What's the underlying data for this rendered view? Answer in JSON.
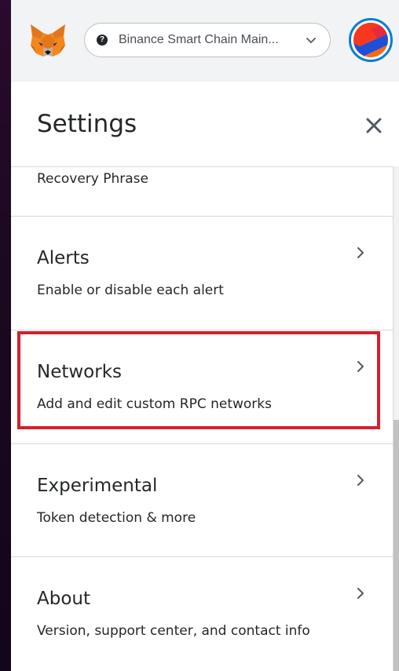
{
  "header": {
    "network": "Binance Smart Chain Main...",
    "network_icon": "network-dot-icon"
  },
  "settings": {
    "title": "Settings",
    "close_icon": "close-icon"
  },
  "items": [
    {
      "title": "",
      "desc": "Recovery Phrase"
    },
    {
      "title": "Alerts",
      "desc": "Enable or disable each alert"
    },
    {
      "title": "Networks",
      "desc": "Add and edit custom RPC networks"
    },
    {
      "title": "Experimental",
      "desc": "Token detection & more"
    },
    {
      "title": "About",
      "desc": "Version, support center, and contact info"
    }
  ],
  "colors": {
    "highlight": "#d4202b",
    "avatar_ring": "#037dd6"
  }
}
